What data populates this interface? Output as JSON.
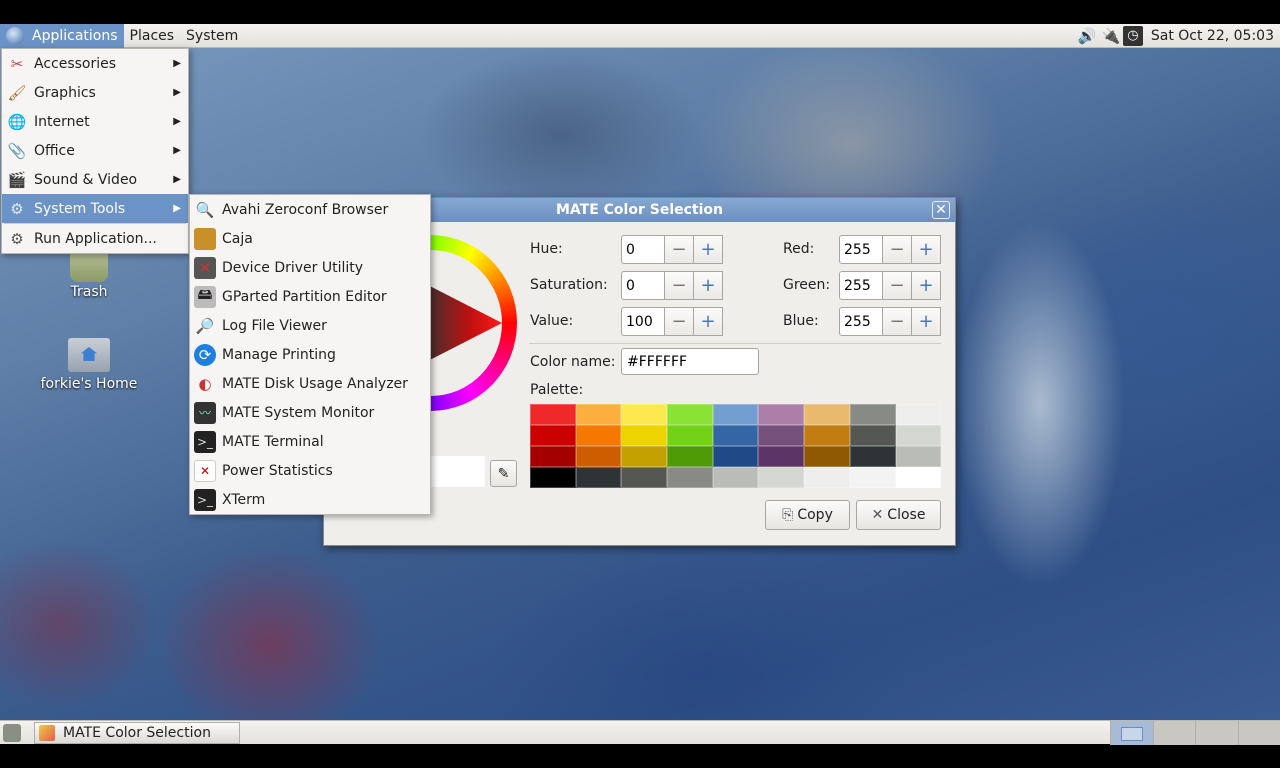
{
  "top_panel": {
    "menus": [
      "Applications",
      "Places",
      "System"
    ],
    "clock": "Sat Oct 22, 05:03"
  },
  "desktop": {
    "icons": [
      {
        "label": "Trash"
      },
      {
        "label": "forkie's Home"
      }
    ]
  },
  "applications_menu": {
    "items": [
      {
        "label": "Accessories",
        "icon": "accessories-icon"
      },
      {
        "label": "Graphics",
        "icon": "graphics-icon"
      },
      {
        "label": "Internet",
        "icon": "internet-icon"
      },
      {
        "label": "Office",
        "icon": "office-icon"
      },
      {
        "label": "Sound & Video",
        "icon": "sound-video-icon"
      },
      {
        "label": "System Tools",
        "icon": "system-tools-icon"
      },
      {
        "label": "Run Application...",
        "icon": "run-icon"
      }
    ]
  },
  "system_tools_menu": {
    "items": [
      {
        "label": "Avahi Zeroconf Browser",
        "icon": "avahi-icon"
      },
      {
        "label": "Caja",
        "icon": "caja-icon"
      },
      {
        "label": "Device Driver Utility",
        "icon": "driver-icon"
      },
      {
        "label": "GParted Partition Editor",
        "icon": "gparted-icon"
      },
      {
        "label": "Log File Viewer",
        "icon": "log-viewer-icon"
      },
      {
        "label": "Manage Printing",
        "icon": "printing-icon"
      },
      {
        "label": "MATE Disk Usage Analyzer",
        "icon": "disk-usage-icon"
      },
      {
        "label": "MATE System Monitor",
        "icon": "system-monitor-icon"
      },
      {
        "label": "MATE Terminal",
        "icon": "terminal-icon"
      },
      {
        "label": "Power Statistics",
        "icon": "power-statistics-icon"
      },
      {
        "label": "XTerm",
        "icon": "xterm-icon"
      }
    ]
  },
  "dialog": {
    "title": "MATE Color Selection",
    "hue_label": "Hue:",
    "hue": "0",
    "saturation_label": "Saturation:",
    "saturation": "0",
    "value_label": "Value:",
    "value": "100",
    "red_label": "Red:",
    "red": "255",
    "green_label": "Green:",
    "green": "255",
    "blue_label": "Blue:",
    "blue": "255",
    "color_name_label": "Color name:",
    "color_name": "#FFFFFF",
    "palette_label": "Palette:",
    "palette": [
      "#ef2929",
      "#fcaf3e",
      "#fce94f",
      "#8ae234",
      "#729fcf",
      "#ad7fa8",
      "#e9b96e",
      "#888a85",
      "#eeeeec",
      "#cc0000",
      "#f57900",
      "#edd400",
      "#73d216",
      "#3465a4",
      "#75507b",
      "#c17d11",
      "#555753",
      "#d3d7cf",
      "#a40000",
      "#ce5c00",
      "#c4a000",
      "#4e9a06",
      "#204a87",
      "#5c3566",
      "#8f5902",
      "#2e3436",
      "#babdb6",
      "#000000",
      "#2e3436",
      "#555753",
      "#888a85",
      "#babdb6",
      "#d3d7cf",
      "#eeeeec",
      "#f3f3f3",
      "#ffffff"
    ],
    "copy_label": "Copy",
    "close_label": "Close"
  },
  "bottom_panel": {
    "task_label": "MATE Color Selection"
  }
}
